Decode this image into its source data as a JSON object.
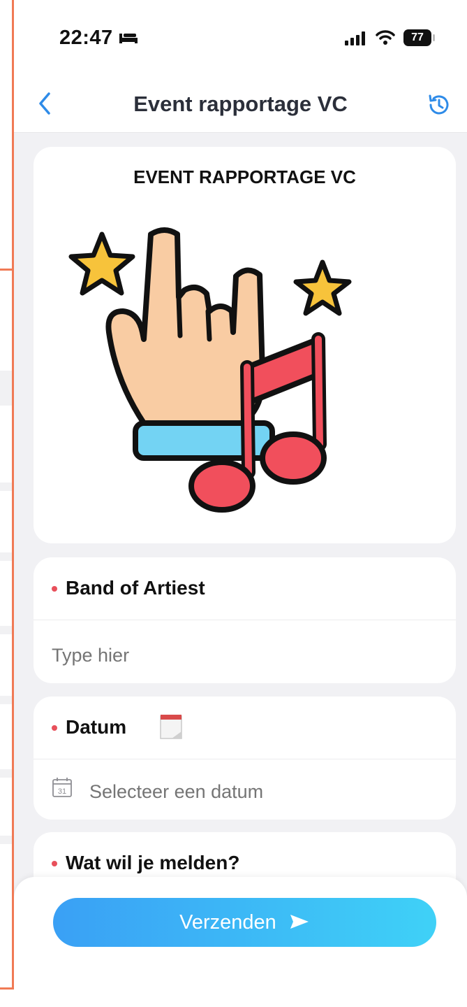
{
  "statusbar": {
    "time": "22:47",
    "battery": "77",
    "icons": [
      "bed-icon",
      "signal-icon",
      "wifi-icon",
      "battery-icon"
    ]
  },
  "navbar": {
    "title": "Event rapportage VC",
    "back_icon": "chevron-left-icon",
    "history_icon": "history-icon"
  },
  "header_card": {
    "title": "EVENT RAPPORTAGE VC",
    "image": "rock-hand-music-note-illustration"
  },
  "fields": {
    "band": {
      "label": "Band of Artiest",
      "placeholder": "Type hier"
    },
    "date": {
      "label": "Datum",
      "placeholder": "Selecteer een datum",
      "calendar_day": "31"
    },
    "report": {
      "label": "Wat wil je melden?"
    }
  },
  "submit": {
    "label": "Verzenden",
    "icon": "send-icon"
  },
  "colors": {
    "accent": "#3aa0f5",
    "accent_end": "#3fd1f7",
    "required_dot": "#e8505b",
    "nav_icon": "#2e8be8"
  }
}
